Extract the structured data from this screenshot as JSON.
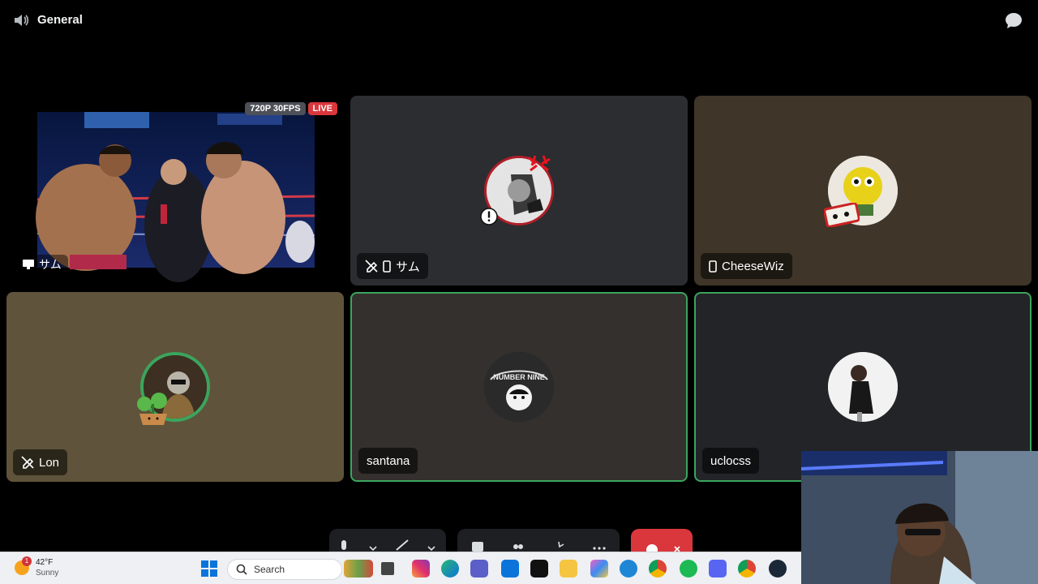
{
  "header": {
    "channel_name": "General"
  },
  "stream": {
    "resolution_badge": "720P 30FPS",
    "live_badge": "LIVE",
    "streamer_name": "サム"
  },
  "participants": [
    {
      "name": "サム",
      "status": [
        "camera-off",
        "mobile"
      ]
    },
    {
      "name": "CheeseWiz",
      "status": [
        "mobile"
      ]
    },
    {
      "name": "Lon",
      "status": [
        "camera-off"
      ]
    },
    {
      "name": "santana",
      "status": []
    },
    {
      "name": "uclocss",
      "status": []
    }
  ],
  "taskbar": {
    "weather": {
      "temp": "42°F",
      "condition": "Sunny",
      "badge": "1"
    },
    "search_label": "Search",
    "apps": [
      "file-explorer",
      "instagram",
      "edge",
      "teams",
      "store",
      "call-of-duty",
      "folder",
      "copilot",
      "vscode",
      "chrome",
      "spotify",
      "discord",
      "chrome-profile",
      "steam"
    ]
  },
  "colors": {
    "background": "#000000",
    "speaking": "#3ba55d",
    "live": "#da373c",
    "end_call": "#da373c"
  }
}
